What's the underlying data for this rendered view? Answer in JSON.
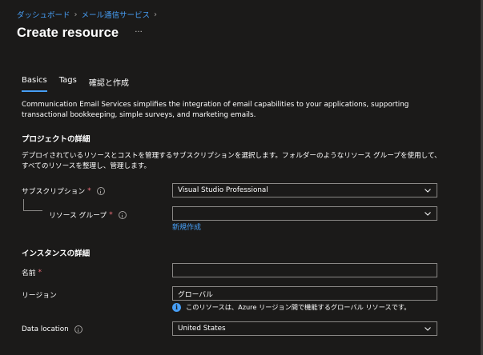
{
  "breadcrumb": {
    "items": [
      "ダッシュボード",
      "メール通信サービス"
    ]
  },
  "page": {
    "title": "Create resource",
    "more": "···"
  },
  "tabs": [
    {
      "label": "Basics",
      "active": true
    },
    {
      "label": "Tags",
      "active": false
    },
    {
      "label": "確認と作成",
      "active": false
    }
  ],
  "intro": {
    "text": "Communication Email Services simplifies the integration of email capabilities to your applications, supporting transactional bookkeeping, simple surveys, and marketing emails."
  },
  "project": {
    "title": "プロジェクトの詳細",
    "description": "デプロイされているリソースとコストを管理するサブスクリプションを選択します。フォルダーのようなリソース グループを使用して、すべてのリソースを整理し、管理します。",
    "subscription": {
      "label": "サブスクリプション",
      "required": "*",
      "value": "Visual Studio Professional"
    },
    "resource_group": {
      "label": "リソース グループ",
      "required": "*",
      "value": "",
      "create_link": "新規作成"
    }
  },
  "instance": {
    "title": "インスタンスの詳細",
    "name": {
      "label": "名前",
      "required": "*",
      "value": ""
    },
    "region": {
      "label": "リージョン",
      "value": "グローバル",
      "hint": "このリソースは、Azure リージョン間で機能するグローバル リソースです。"
    },
    "data_location": {
      "label": "Data location",
      "value": "United States"
    }
  },
  "colors": {
    "accent": "#479ef5",
    "required": "#f1707b",
    "background": "#1b1a19",
    "border": "#8a8886"
  }
}
